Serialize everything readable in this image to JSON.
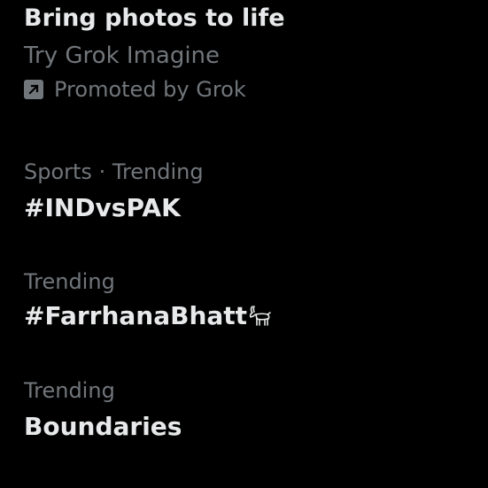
{
  "promo": {
    "headline": "Bring photos to life",
    "tagline": "Try Grok Imagine",
    "promoted_label": "Promoted by Grok",
    "icon": "promoted-arrow-icon"
  },
  "trends": [
    {
      "context": "Sports · Trending",
      "name": "#INDvsPAK"
    },
    {
      "context": "Trending",
      "name": "#FarrhanaBhatt",
      "emoji": "goat-icon"
    },
    {
      "context": "Trending",
      "name": "Boundaries"
    }
  ],
  "colors": {
    "background": "#000000",
    "primary_text": "#e7e9ea",
    "secondary_text": "#71767b"
  }
}
